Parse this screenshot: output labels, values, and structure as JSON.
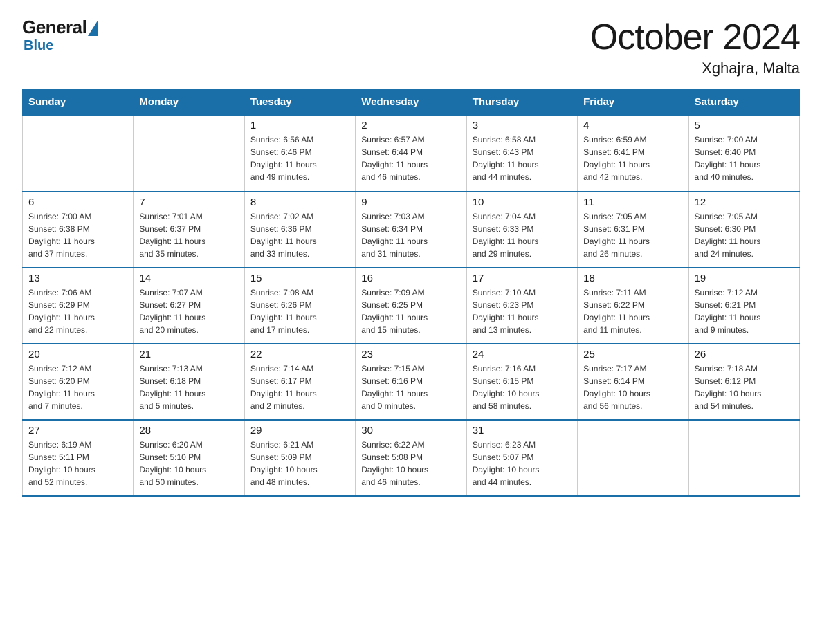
{
  "header": {
    "logo": {
      "general": "General",
      "blue": "Blue"
    },
    "title": "October 2024",
    "subtitle": "Xghajra, Malta"
  },
  "calendar": {
    "days_of_week": [
      "Sunday",
      "Monday",
      "Tuesday",
      "Wednesday",
      "Thursday",
      "Friday",
      "Saturday"
    ],
    "weeks": [
      [
        {
          "day": "",
          "info": ""
        },
        {
          "day": "",
          "info": ""
        },
        {
          "day": "1",
          "info": "Sunrise: 6:56 AM\nSunset: 6:46 PM\nDaylight: 11 hours\nand 49 minutes."
        },
        {
          "day": "2",
          "info": "Sunrise: 6:57 AM\nSunset: 6:44 PM\nDaylight: 11 hours\nand 46 minutes."
        },
        {
          "day": "3",
          "info": "Sunrise: 6:58 AM\nSunset: 6:43 PM\nDaylight: 11 hours\nand 44 minutes."
        },
        {
          "day": "4",
          "info": "Sunrise: 6:59 AM\nSunset: 6:41 PM\nDaylight: 11 hours\nand 42 minutes."
        },
        {
          "day": "5",
          "info": "Sunrise: 7:00 AM\nSunset: 6:40 PM\nDaylight: 11 hours\nand 40 minutes."
        }
      ],
      [
        {
          "day": "6",
          "info": "Sunrise: 7:00 AM\nSunset: 6:38 PM\nDaylight: 11 hours\nand 37 minutes."
        },
        {
          "day": "7",
          "info": "Sunrise: 7:01 AM\nSunset: 6:37 PM\nDaylight: 11 hours\nand 35 minutes."
        },
        {
          "day": "8",
          "info": "Sunrise: 7:02 AM\nSunset: 6:36 PM\nDaylight: 11 hours\nand 33 minutes."
        },
        {
          "day": "9",
          "info": "Sunrise: 7:03 AM\nSunset: 6:34 PM\nDaylight: 11 hours\nand 31 minutes."
        },
        {
          "day": "10",
          "info": "Sunrise: 7:04 AM\nSunset: 6:33 PM\nDaylight: 11 hours\nand 29 minutes."
        },
        {
          "day": "11",
          "info": "Sunrise: 7:05 AM\nSunset: 6:31 PM\nDaylight: 11 hours\nand 26 minutes."
        },
        {
          "day": "12",
          "info": "Sunrise: 7:05 AM\nSunset: 6:30 PM\nDaylight: 11 hours\nand 24 minutes."
        }
      ],
      [
        {
          "day": "13",
          "info": "Sunrise: 7:06 AM\nSunset: 6:29 PM\nDaylight: 11 hours\nand 22 minutes."
        },
        {
          "day": "14",
          "info": "Sunrise: 7:07 AM\nSunset: 6:27 PM\nDaylight: 11 hours\nand 20 minutes."
        },
        {
          "day": "15",
          "info": "Sunrise: 7:08 AM\nSunset: 6:26 PM\nDaylight: 11 hours\nand 17 minutes."
        },
        {
          "day": "16",
          "info": "Sunrise: 7:09 AM\nSunset: 6:25 PM\nDaylight: 11 hours\nand 15 minutes."
        },
        {
          "day": "17",
          "info": "Sunrise: 7:10 AM\nSunset: 6:23 PM\nDaylight: 11 hours\nand 13 minutes."
        },
        {
          "day": "18",
          "info": "Sunrise: 7:11 AM\nSunset: 6:22 PM\nDaylight: 11 hours\nand 11 minutes."
        },
        {
          "day": "19",
          "info": "Sunrise: 7:12 AM\nSunset: 6:21 PM\nDaylight: 11 hours\nand 9 minutes."
        }
      ],
      [
        {
          "day": "20",
          "info": "Sunrise: 7:12 AM\nSunset: 6:20 PM\nDaylight: 11 hours\nand 7 minutes."
        },
        {
          "day": "21",
          "info": "Sunrise: 7:13 AM\nSunset: 6:18 PM\nDaylight: 11 hours\nand 5 minutes."
        },
        {
          "day": "22",
          "info": "Sunrise: 7:14 AM\nSunset: 6:17 PM\nDaylight: 11 hours\nand 2 minutes."
        },
        {
          "day": "23",
          "info": "Sunrise: 7:15 AM\nSunset: 6:16 PM\nDaylight: 11 hours\nand 0 minutes."
        },
        {
          "day": "24",
          "info": "Sunrise: 7:16 AM\nSunset: 6:15 PM\nDaylight: 10 hours\nand 58 minutes."
        },
        {
          "day": "25",
          "info": "Sunrise: 7:17 AM\nSunset: 6:14 PM\nDaylight: 10 hours\nand 56 minutes."
        },
        {
          "day": "26",
          "info": "Sunrise: 7:18 AM\nSunset: 6:12 PM\nDaylight: 10 hours\nand 54 minutes."
        }
      ],
      [
        {
          "day": "27",
          "info": "Sunrise: 6:19 AM\nSunset: 5:11 PM\nDaylight: 10 hours\nand 52 minutes."
        },
        {
          "day": "28",
          "info": "Sunrise: 6:20 AM\nSunset: 5:10 PM\nDaylight: 10 hours\nand 50 minutes."
        },
        {
          "day": "29",
          "info": "Sunrise: 6:21 AM\nSunset: 5:09 PM\nDaylight: 10 hours\nand 48 minutes."
        },
        {
          "day": "30",
          "info": "Sunrise: 6:22 AM\nSunset: 5:08 PM\nDaylight: 10 hours\nand 46 minutes."
        },
        {
          "day": "31",
          "info": "Sunrise: 6:23 AM\nSunset: 5:07 PM\nDaylight: 10 hours\nand 44 minutes."
        },
        {
          "day": "",
          "info": ""
        },
        {
          "day": "",
          "info": ""
        }
      ]
    ]
  }
}
